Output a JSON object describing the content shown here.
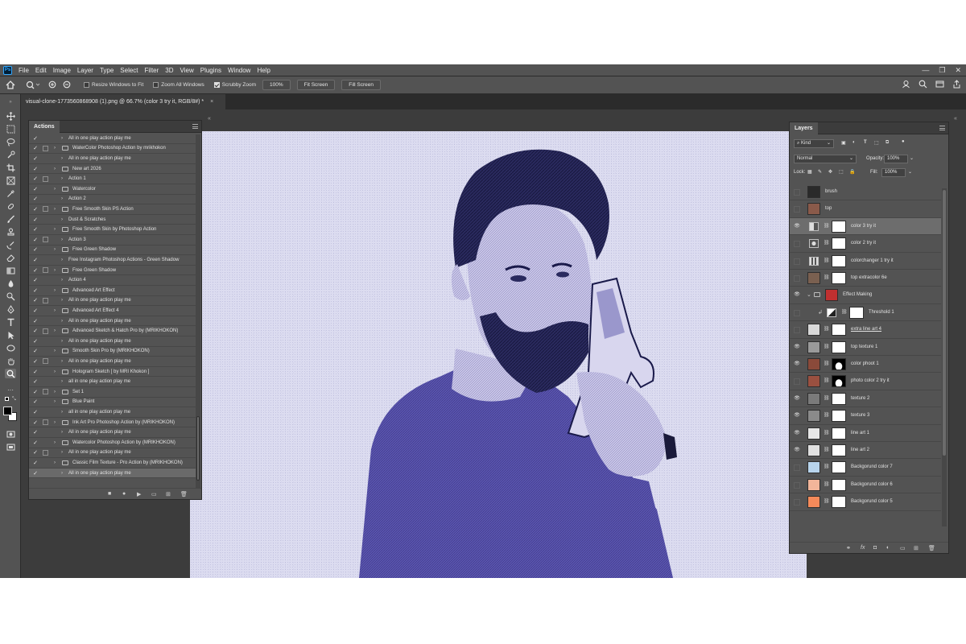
{
  "app": {
    "logo": "Ps"
  },
  "menu": [
    "File",
    "Edit",
    "Image",
    "Layer",
    "Type",
    "Select",
    "Filter",
    "3D",
    "View",
    "Plugins",
    "Window",
    "Help"
  ],
  "options": {
    "resize_windows": "Resize Windows to Fit",
    "zoom_all": "Zoom All Windows",
    "scrubby_zoom": "Scrubby Zoom",
    "zoom_value": "100%",
    "fit_screen": "Fit Screen",
    "fill_screen": "Fill Screen"
  },
  "document": {
    "tab_title": "visual-clone-1773560868908 (1).png @ 66.7% (color 3 try it, RGB/8#) *",
    "close": "×"
  },
  "actions_panel": {
    "title": "Actions",
    "items": [
      {
        "label": "All in one play action play me",
        "kind": "action"
      },
      {
        "label": "WaterColor Photoshop Action by mrikhokon",
        "kind": "set"
      },
      {
        "label": "All in one play action play me",
        "kind": "action"
      },
      {
        "label": "New art 2026",
        "kind": "set"
      },
      {
        "label": "Action 1",
        "kind": "action"
      },
      {
        "label": "Watercolor",
        "kind": "set"
      },
      {
        "label": "Action 2",
        "kind": "action"
      },
      {
        "label": "Free Smooth Skin PS Action",
        "kind": "set"
      },
      {
        "label": "Dust & Scratches",
        "kind": "action"
      },
      {
        "label": "Free Smooth Skin by Photoshop Action",
        "kind": "set"
      },
      {
        "label": "Action 3",
        "kind": "action"
      },
      {
        "label": "Free Green Shadow",
        "kind": "set"
      },
      {
        "label": "Free Instagram Photoshop Actions - Green Shadow",
        "kind": "action"
      },
      {
        "label": "Free Green Shadow",
        "kind": "set"
      },
      {
        "label": "Action 4",
        "kind": "action"
      },
      {
        "label": "Advanced Art Effect",
        "kind": "set"
      },
      {
        "label": "All in one play action play me",
        "kind": "action"
      },
      {
        "label": "Advanced Art Effect 4",
        "kind": "set"
      },
      {
        "label": "All in one play action play me",
        "kind": "action"
      },
      {
        "label": "Advanced Sketch & Hatch Pro by (MRIKHOKON)",
        "kind": "set"
      },
      {
        "label": "All in one play action play me",
        "kind": "action"
      },
      {
        "label": "Smooth Skin Pro by (MRIKHOKON)",
        "kind": "set"
      },
      {
        "label": "All in one play action play me",
        "kind": "action"
      },
      {
        "label": "Hologram Sketch [ by MRI Khokon ]",
        "kind": "set"
      },
      {
        "label": "all in one play action play me",
        "kind": "action"
      },
      {
        "label": "Set 1",
        "kind": "set"
      },
      {
        "label": "Blue Paint",
        "kind": "set"
      },
      {
        "label": "all in one play action play me",
        "kind": "action"
      },
      {
        "label": "Ink Art Pro Photoshop Action by (MRIKHOKON)",
        "kind": "set"
      },
      {
        "label": "All in one play action play me",
        "kind": "action"
      },
      {
        "label": "Watercolor Photoshop Action by (MRIKHOKON)",
        "kind": "set"
      },
      {
        "label": "All in one play action play me",
        "kind": "action"
      },
      {
        "label": "Classic Film Texture - Pro Action by (MRIKHOKON)",
        "kind": "set"
      },
      {
        "label": "All in one play action play me",
        "kind": "action"
      }
    ]
  },
  "layers_panel": {
    "title": "Layers",
    "filter": "Kind",
    "blend_mode": "Normal",
    "opacity_label": "Opacity:",
    "opacity_value": "100%",
    "lock_label": "Lock:",
    "fill_label": "Fill:",
    "fill_value": "100%",
    "layers": [
      {
        "name": "brush",
        "visible": false,
        "type": "pixel",
        "thumb": "#2a2a2a",
        "mask": false
      },
      {
        "name": "top",
        "visible": false,
        "type": "pixel",
        "thumb": "#8a5a4a",
        "mask": false
      },
      {
        "name": "color 3 try it",
        "visible": true,
        "type": "adjust",
        "mask": true,
        "selected": true
      },
      {
        "name": "color 2 try it",
        "visible": false,
        "type": "adjust2",
        "mask": true
      },
      {
        "name": "colorchanger 1 try it",
        "visible": false,
        "type": "adjust3",
        "mask": true
      },
      {
        "name": "top extracolor 6e",
        "visible": false,
        "type": "pixel",
        "thumb": "#7a6050",
        "mask": true
      },
      {
        "name": "Effect Making",
        "visible": true,
        "type": "group",
        "thumb": "#c03030",
        "mask": false
      },
      {
        "name": "Threshold 1",
        "visible": false,
        "type": "threshold",
        "mask": true
      },
      {
        "name": "extra line art 4",
        "visible": false,
        "type": "pixel",
        "thumb": "#d8d8d8",
        "mask": true
      },
      {
        "name": "top texture 1",
        "visible": true,
        "type": "pixel",
        "thumb": "#9a9a9a",
        "mask": true
      },
      {
        "name": "color phoot 1",
        "visible": true,
        "type": "pixel",
        "thumb": "#8a4a3a",
        "mask": true,
        "maskdark": true
      },
      {
        "name": "photo color 2 try it",
        "visible": false,
        "type": "pixel",
        "thumb": "#9a5040",
        "mask": true,
        "maskdark": true
      },
      {
        "name": "texture 2",
        "visible": true,
        "type": "pixel",
        "thumb": "#7a7a7a",
        "mask": true
      },
      {
        "name": "texture 3",
        "visible": true,
        "type": "pixel",
        "thumb": "#8a8a8a",
        "mask": true
      },
      {
        "name": "line art 1",
        "visible": true,
        "type": "pixel",
        "thumb": "#e8e8e8",
        "mask": true
      },
      {
        "name": "line art 2",
        "visible": true,
        "type": "pixel",
        "thumb": "#e0e0e0",
        "mask": true
      },
      {
        "name": "Backgorund color 7",
        "visible": false,
        "type": "solid",
        "thumb": "#b8d4ec",
        "mask": true
      },
      {
        "name": "Backgorund color 6",
        "visible": false,
        "type": "solid",
        "thumb": "#f2b59a",
        "mask": true
      },
      {
        "name": "Backgorund color 5",
        "visible": false,
        "type": "solid",
        "thumb": "#f58a5a",
        "mask": true
      }
    ]
  },
  "colors": {
    "ui_dark": "#3c3c3c",
    "ui_panel": "#535353",
    "canvas_bg": "#dcdcf0",
    "portrait_ink": "#2a2a6e"
  }
}
